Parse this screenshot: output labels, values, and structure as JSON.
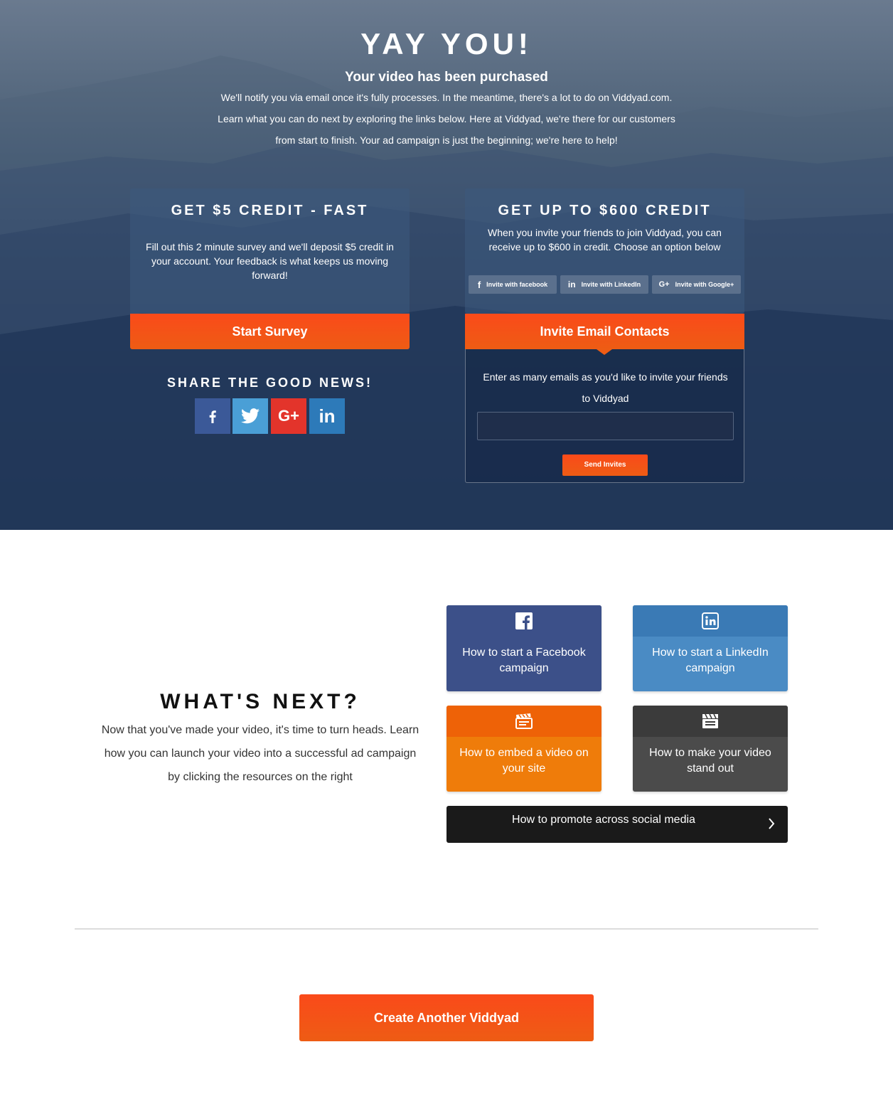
{
  "hero": {
    "title": "YAY YOU!",
    "subtitle": "Your video has been purchased",
    "text": "We'll notify you via email once it's fully processes. In the meantime, there's a lot to do on Viddyad.com. Learn what you can do next by exploring the links below. Here at Viddyad, we're there for our customers from start to finish. Your ad campaign is just the beginning; we're here to help!"
  },
  "survey": {
    "title": "GET $5 CREDIT - FAST",
    "text": "Fill out this 2 minute survey and we'll deposit $5 credit in your account. Your feedback is what keeps us moving forward!",
    "button": "Start Survey"
  },
  "share": {
    "title": "SHARE THE GOOD NEWS!",
    "buttons": [
      {
        "icon": "facebook-icon",
        "glyph": "f",
        "color": "#3b5998"
      },
      {
        "icon": "twitter-icon",
        "glyph": "t",
        "color": "#4a9fd6"
      },
      {
        "icon": "google-plus-icon",
        "glyph": "G+",
        "color": "#e3342b"
      },
      {
        "icon": "linkedin-icon",
        "glyph": "in",
        "color": "#2d7ab9"
      }
    ]
  },
  "invite": {
    "title": "GET UP TO $600 CREDIT",
    "text": "When you invite your friends to join Viddyad, you can receive up to $600 in credit. Choose an option below",
    "social": [
      {
        "label": "Invite with facebook",
        "glyph": "f"
      },
      {
        "label": "Invite with LinkedIn",
        "glyph": "in"
      },
      {
        "label": "Invite with Google+",
        "glyph": "G+"
      }
    ],
    "button": "Invite Email Contacts",
    "email_text": "Enter as many emails as you'd like to invite your friends to Viddyad",
    "email_value": "",
    "send_button": "Send Invites"
  },
  "next": {
    "title": "WHAT'S NEXT?",
    "text": "Now that you've made your video, it's time to turn heads. Learn how you can launch your video into a successful ad campaign by clicking the resources on the right",
    "tiles": [
      {
        "label": "How to start a Facebook campaign",
        "icon": "facebook-icon"
      },
      {
        "label": "How to start a LinkedIn campaign",
        "icon": "linkedin-icon"
      },
      {
        "label": "How to embed a video on your site",
        "icon": "clapperboard-icon"
      },
      {
        "label": "How to make your video stand out",
        "icon": "clapperboard-icon"
      }
    ],
    "promo": "How to promote across social media"
  },
  "create_button": "Create Another Viddyad",
  "colors": {
    "accent": "#f54a17",
    "facebook": "#3c5089",
    "linkedin": "#4a8bc4",
    "embed": "#ef7c0a",
    "standout": "#4b4b4b"
  }
}
